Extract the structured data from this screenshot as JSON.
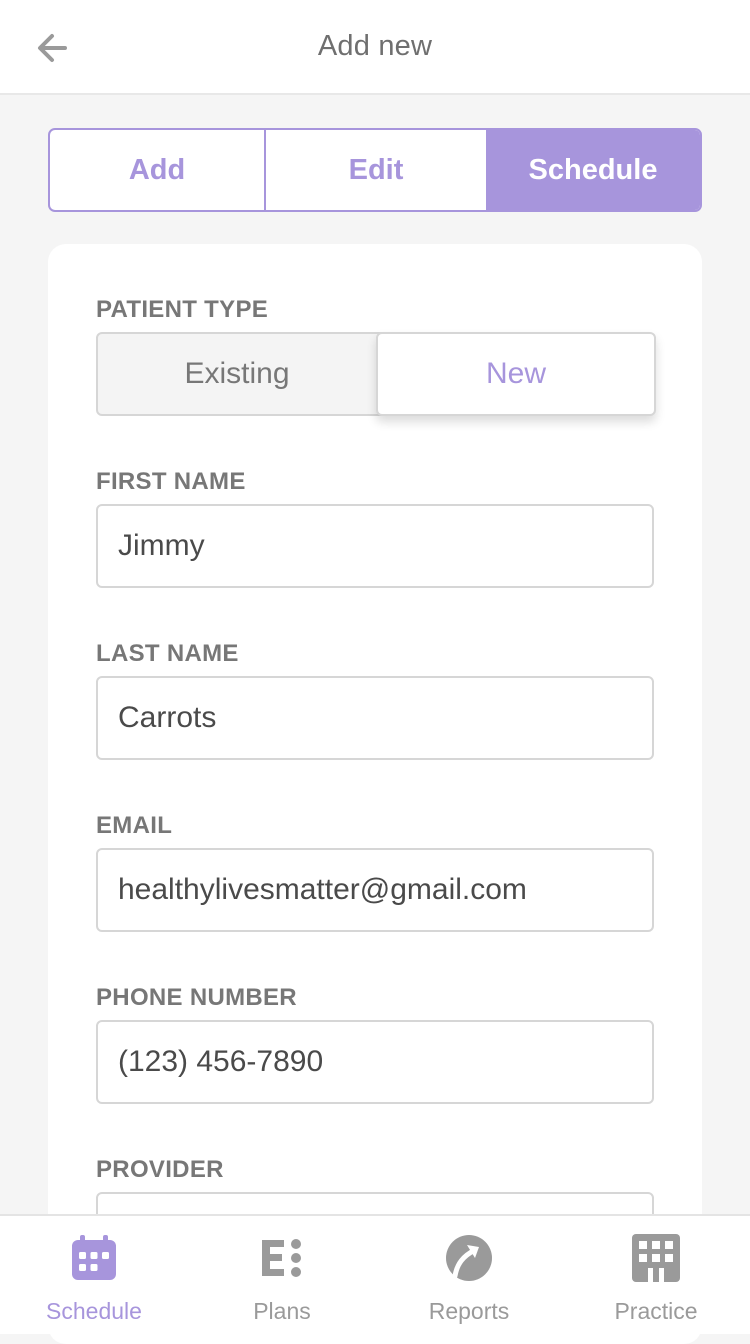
{
  "header": {
    "title": "Add new",
    "back_icon": "arrow-left-icon"
  },
  "segments": {
    "add": "Add",
    "edit": "Edit",
    "schedule": "Schedule",
    "selected": "Schedule"
  },
  "form": {
    "patient_type": {
      "label": "PATIENT TYPE",
      "existing": "Existing",
      "new": "New",
      "selected": "New"
    },
    "first_name": {
      "label": "FIRST NAME",
      "value": "Jimmy"
    },
    "last_name": {
      "label": "LAST NAME",
      "value": "Carrots"
    },
    "email": {
      "label": "EMAIL",
      "value": "healthylivesmatter@gmail.com"
    },
    "phone": {
      "label": "PHONE NUMBER",
      "value": "(123) 456-7890"
    },
    "provider": {
      "label": "PROVIDER",
      "value": ""
    }
  },
  "tabbar": {
    "items": [
      {
        "label": "Schedule",
        "icon": "calendar-icon",
        "active": true
      },
      {
        "label": "Plans",
        "icon": "plans-icon",
        "active": false
      },
      {
        "label": "Reports",
        "icon": "reports-icon",
        "active": false
      },
      {
        "label": "Practice",
        "icon": "practice-grid-icon",
        "active": false
      }
    ]
  },
  "colors": {
    "accent": "#a795dc",
    "background": "#f5f5f5",
    "text": "#4f4f4f",
    "muted": "#9a9a9a",
    "border": "#d6d6d6"
  }
}
